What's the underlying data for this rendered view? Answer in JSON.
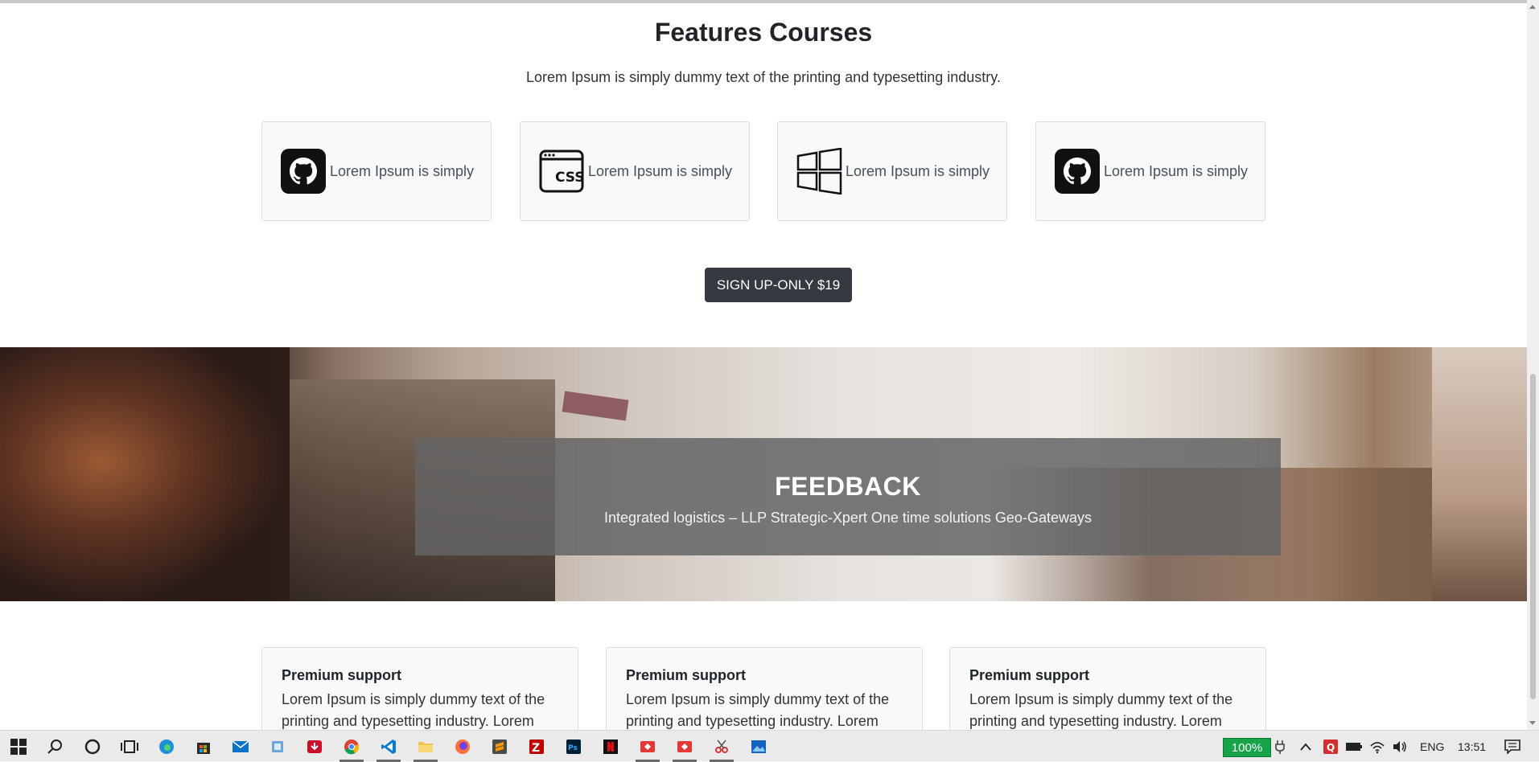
{
  "features": {
    "title": "Features Courses",
    "subtitle": "Lorem Ipsum is simply dummy text of the printing and typesetting industry.",
    "cards": [
      {
        "icon": "github-icon",
        "label": "Lorem Ipsum is simply"
      },
      {
        "icon": "css-icon",
        "label": "Lorem Ipsum is simply"
      },
      {
        "icon": "windows-icon",
        "label": "Lorem Ipsum is simply"
      },
      {
        "icon": "github-icon",
        "label": "Lorem Ipsum is simply"
      }
    ],
    "signup_label": "SIGN UP-ONLY $19"
  },
  "feedback": {
    "title": "FEEDBACK",
    "text": "Integrated logistics – LLP Strategic-Xpert One time solutions Geo-Gateways"
  },
  "support": {
    "cards": [
      {
        "title": "Premium support",
        "text": "Lorem Ipsum is simply dummy text of the printing and typesetting industry. Lorem"
      },
      {
        "title": "Premium support",
        "text": "Lorem Ipsum is simply dummy text of the printing and typesetting industry. Lorem"
      },
      {
        "title": "Premium support",
        "text": "Lorem Ipsum is simply dummy text of the printing and typesetting industry. Lorem"
      }
    ]
  },
  "taskbar": {
    "apps": [
      "start-icon",
      "search-icon",
      "cortana-icon",
      "task-view-icon",
      "edge-icon",
      "store-icon",
      "mail-icon",
      "app-icon",
      "download-icon",
      "chrome-icon",
      "vscode-icon",
      "file-explorer-icon",
      "firefox-icon",
      "sublime-icon",
      "filezilla-icon",
      "photoshop-icon",
      "netflix-icon",
      "app-red-icon",
      "app-red-icon",
      "snipping-icon",
      "photos-icon"
    ],
    "battery": "100%",
    "language": "ENG",
    "time": "13:51"
  },
  "colors": {
    "button_dark": "#343a40",
    "card_bg": "#f8f9fa",
    "battery_green": "#16a34a"
  }
}
